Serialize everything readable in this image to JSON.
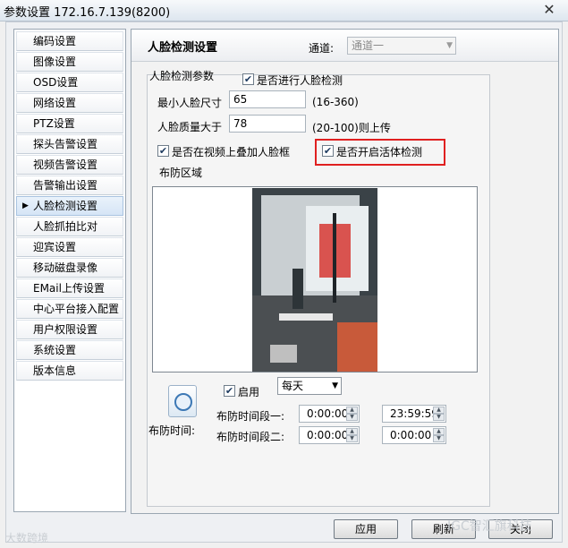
{
  "window": {
    "title": "参数设置 172.16.7.139(8200)",
    "close_glyph": "✕"
  },
  "sidebar": {
    "items": [
      {
        "label": "编码设置",
        "active": false
      },
      {
        "label": "图像设置",
        "active": false
      },
      {
        "label": "OSD设置",
        "active": false
      },
      {
        "label": "网络设置",
        "active": false
      },
      {
        "label": "PTZ设置",
        "active": false
      },
      {
        "label": "探头告警设置",
        "active": false
      },
      {
        "label": "视频告警设置",
        "active": false
      },
      {
        "label": "告警输出设置",
        "active": false
      },
      {
        "label": "人脸检测设置",
        "active": true
      },
      {
        "label": "人脸抓拍比对",
        "active": false
      },
      {
        "label": "迎宾设置",
        "active": false
      },
      {
        "label": "移动磁盘录像",
        "active": false
      },
      {
        "label": "EMail上传设置",
        "active": false
      },
      {
        "label": "中心平台接入配置",
        "active": false
      },
      {
        "label": "用户权限设置",
        "active": false
      },
      {
        "label": "系统设置",
        "active": false
      },
      {
        "label": "版本信息",
        "active": false
      }
    ]
  },
  "main": {
    "title": "人脸检测设置",
    "channel_label": "通道:",
    "channel_value": "通道一",
    "params_group_label": "人脸检测参数",
    "enable_face_detect_label": "是否进行人脸检测",
    "enable_face_detect_checked": true,
    "min_face_label": "最小人脸尺寸",
    "min_face_value": "65",
    "min_face_range": "(16-360)",
    "quality_label": "人脸质量大于",
    "quality_value": "78",
    "quality_note": "(20-100)则上传",
    "overlay_label": "是否在视频上叠加人脸框",
    "overlay_checked": true,
    "liveness_label": "是否开启活体检测",
    "liveness_checked": true,
    "area_label": "布防区域",
    "schedule": {
      "enable_label": "启用",
      "enable_checked": true,
      "frequency": "每天",
      "schedule_label": "布防时间:",
      "period1_label": "布防时间段一:",
      "period1_start": "0:00:00",
      "period1_end": "23:59:59",
      "period2_label": "布防时间段二:",
      "period2_start": "0:00:00",
      "period2_end": "0:00:00"
    }
  },
  "footer": {
    "apply": "应用",
    "refresh": "刷新",
    "close": "关闭"
  },
  "watermarks": {
    "left": "大数跨境",
    "right": "IGC智汇旗科技"
  }
}
